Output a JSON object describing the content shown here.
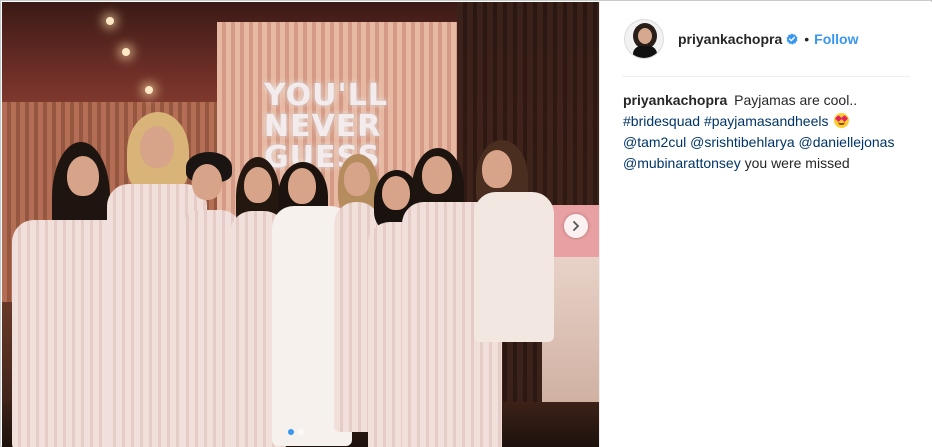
{
  "post": {
    "photo": {
      "sign_lines": [
        "YOU'LL",
        "NEVER",
        "GUESS"
      ],
      "carousel_dots": 2,
      "active_dot": 0
    },
    "author": {
      "username": "priyankachopra",
      "verified": true,
      "bullet": "•",
      "follow_label": "Follow"
    },
    "caption": {
      "username": "priyankachopra",
      "text": "Payjamas are cool..",
      "hashtags": [
        "#bridesquad",
        "#payjamasandheels"
      ],
      "mentions": [
        "@tam2cul",
        "@srishtibehlarya",
        "@daniellejonas",
        "@mubinarattonsey"
      ],
      "ending": "you were missed"
    }
  },
  "colors": {
    "follow_blue": "#3897f0",
    "link_blue": "#003569",
    "text": "#262626"
  },
  "icons": [
    "verified-badge-icon",
    "chevron-right-icon",
    "heart-eyes-emoji-icon"
  ]
}
